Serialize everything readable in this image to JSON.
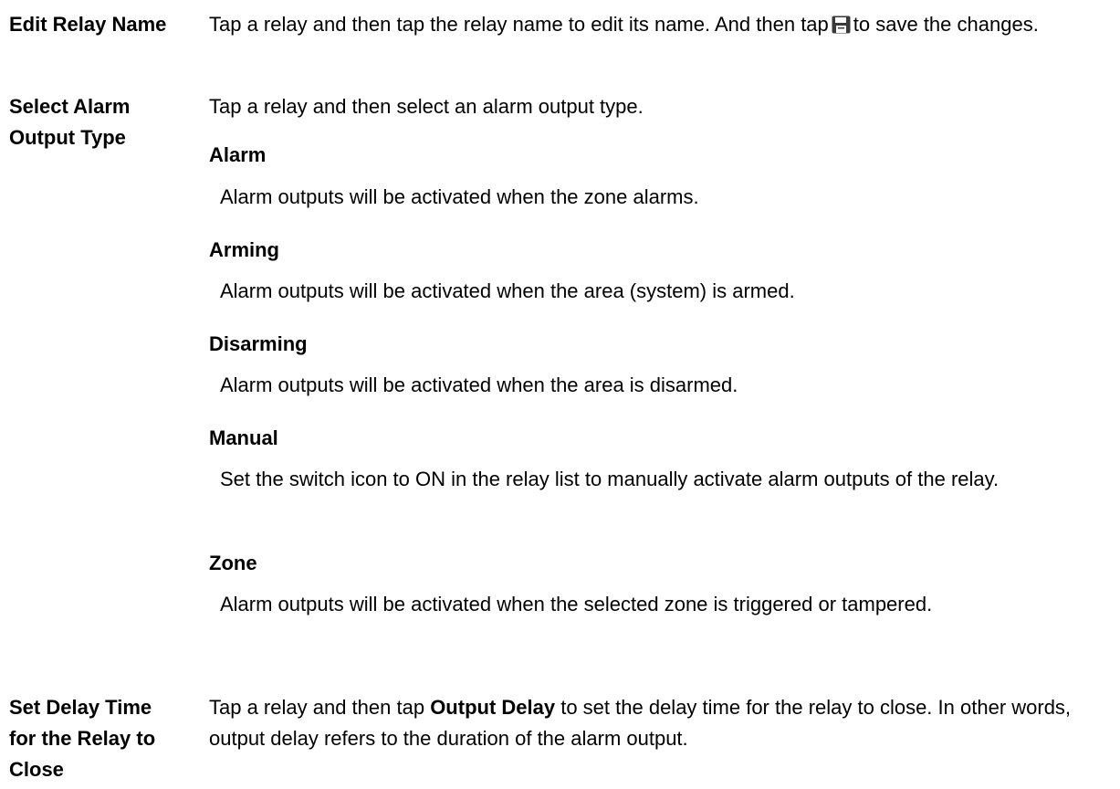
{
  "edit_relay": {
    "term": "Edit Relay Name",
    "desc_before_icon": "Tap a relay and then tap the relay name to edit its name. And then tap",
    "desc_after_icon": "to save the changes.",
    "icon": "save-icon"
  },
  "alarm_output_type": {
    "term": "Select Alarm Output Type",
    "desc": "Tap a relay and then select an alarm output type.",
    "options": [
      {
        "label": "Alarm",
        "desc": "Alarm outputs will be activated when the zone alarms."
      },
      {
        "label": "Arming",
        "desc": "Alarm outputs will be activated when the area (system) is armed."
      },
      {
        "label": "Disarming",
        "desc": "Alarm outputs will be activated when the area is disarmed."
      },
      {
        "label": "Manual",
        "desc": "Set the switch icon to ON in the relay list to manually activate alarm outputs of the relay."
      },
      {
        "label": "Zone",
        "desc": "Alarm outputs will be activated when the selected zone is triggered or tampered."
      }
    ]
  },
  "delay_time": {
    "term": "Set Delay Time for the Relay to Close",
    "desc_before_bold": "Tap a relay and then tap",
    "desc_bold": "Output Delay",
    "desc_after_bold": "to set the delay time for the relay to close. In other words, output delay refers to the duration of the alarm output."
  }
}
